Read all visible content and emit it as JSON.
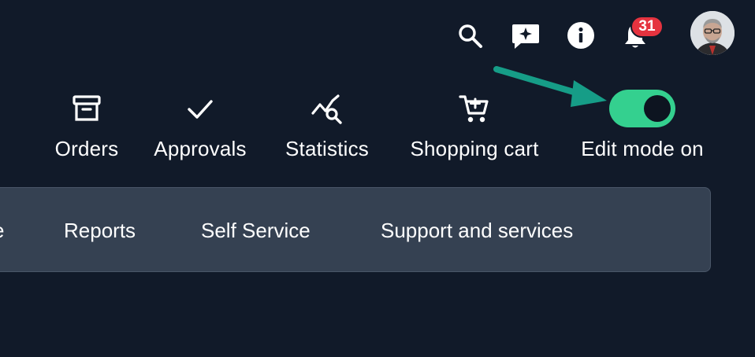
{
  "header": {
    "notifications_count": "31",
    "icons": [
      "search-icon",
      "chat-sparkle-icon",
      "info-icon",
      "bell-icon"
    ]
  },
  "quick_actions": [
    {
      "label": "Orders",
      "icon": "archive-box-icon"
    },
    {
      "label": "Approvals",
      "icon": "checkmark-icon"
    },
    {
      "label": "Statistics",
      "icon": "chart-search-icon"
    },
    {
      "label": "Shopping cart",
      "icon": "cart-icon"
    },
    {
      "label": "Edit mode on",
      "icon": "toggle-switch",
      "state": "on"
    }
  ],
  "nav": {
    "items": [
      "e",
      "Reports",
      "Self Service",
      "Support and services"
    ]
  },
  "colors": {
    "background": "#111a29",
    "nav_background": "#354152",
    "toggle_on": "#34d08f",
    "badge": "#e5333f",
    "annotation_arrow": "#169d87"
  }
}
